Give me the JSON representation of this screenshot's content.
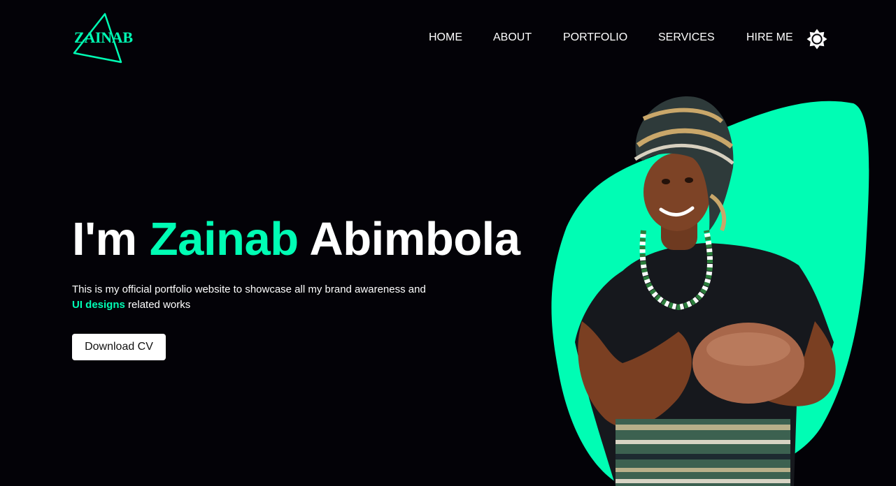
{
  "brand": {
    "logo_text": "ZAINAB"
  },
  "nav": {
    "items": [
      {
        "label": "HOME"
      },
      {
        "label": "ABOUT"
      },
      {
        "label": "PORTFOLIO"
      },
      {
        "label": "SERVICES"
      },
      {
        "label": "HIRE ME"
      }
    ],
    "theme_toggle_icon": "sun-icon"
  },
  "hero": {
    "title_prefix": "I'm",
    "title_first_name": "Zainab",
    "title_last_name": "Abimbola",
    "intro_line": "This is my official portfolio website to showcase all my brand awareness and",
    "intro_highlight": "UI designs",
    "intro_end": "related works",
    "cv_button": "Download CV",
    "portrait_icon": "portrait-photo"
  },
  "colors": {
    "background": "#030207",
    "accent": "#00fdb4",
    "text": "#ffffff"
  }
}
